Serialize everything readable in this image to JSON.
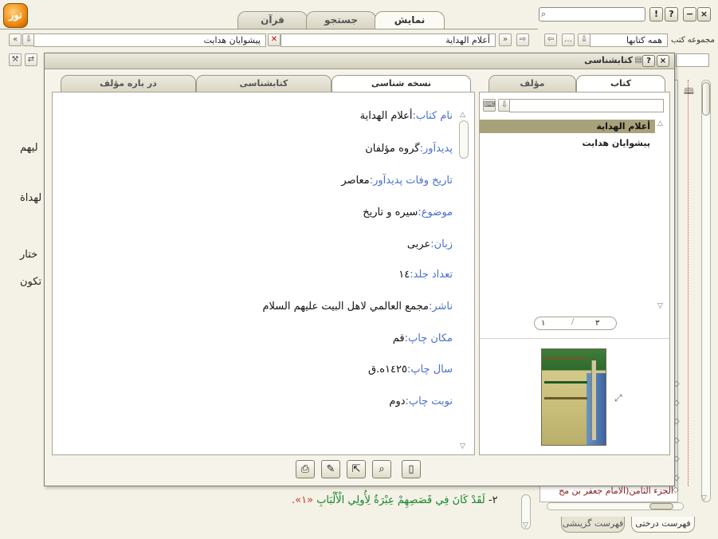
{
  "top_tabs": [
    "نمایش",
    "جستجو",
    "قرآن"
  ],
  "window_buttons": [
    "!",
    "?",
    "−",
    "×"
  ],
  "reader_toolbar": {
    "book_field": "أعلام الهداية",
    "series_field": "پيشوايان هدايت"
  },
  "collection": {
    "label": "مجموعه كتب",
    "value": "همه كتابها",
    "more": "…"
  },
  "background_text": {
    "line1": "ليهم",
    "line2": "لهداة",
    "line3": "ختار",
    "line4": "تكون",
    "quran_number": "٢-",
    "quran_verse": "لَقَدْ كَانَ فِي قَصَصِهِمْ عِبْرَةٌ لِأُولِي الْأَلْبَابِ",
    "quran_ref": "«١»."
  },
  "tree_last_item": "الجزء الثامن(الامام جعفر بن مح",
  "bottom_tabs": [
    "فهرست درختى",
    "فهرست گزينشى"
  ],
  "dialog": {
    "title": "كتابشناسى",
    "tabs_left": [
      "نسخه شناسى",
      "كتابشناسى",
      "در باره مؤلف"
    ],
    "tabs_right": [
      "كتاب",
      "مؤلف"
    ],
    "info": [
      {
        "key": "نام كتاب:",
        "value": "أعلام الهداية"
      },
      {
        "key": "پديدآور:",
        "value": "گروه مؤلفان"
      },
      {
        "key": "تاريخ وفات پديدآور:",
        "value": "معاصر"
      },
      {
        "key": "موضوع:",
        "value": "سيره و تاريخ"
      },
      {
        "key": "زبان:",
        "value": "عربى"
      },
      {
        "key": "تعداد جلد:",
        "value": "١٤"
      },
      {
        "key": "ناشر:",
        "value": "مجمع العالمي لاهل البيت عليهم السلام"
      },
      {
        "key": "مكان چاپ:",
        "value": "قم"
      },
      {
        "key": "سال چاپ:",
        "value": "١٤٢٥ه.ق"
      },
      {
        "key": "نوبت چاپ:",
        "value": "دوم"
      }
    ],
    "book_list": [
      "أعلام الهداية",
      "پيشوايان هدايت"
    ],
    "pager": {
      "current": "٣",
      "total": "١"
    }
  },
  "colors": {
    "accent_key": "#4a6fd0",
    "selected_row": "#a8a27a",
    "quran_green": "#14842a"
  }
}
